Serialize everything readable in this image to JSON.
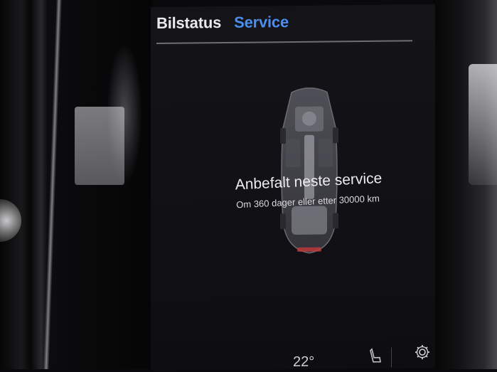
{
  "header": {
    "tabs": [
      {
        "label": "Bilstatus",
        "active": true
      },
      {
        "label": "Service",
        "active": false
      }
    ]
  },
  "service": {
    "headline": "Anbefalt neste service",
    "detail": "Om 360 dager eller etter 30000 km"
  },
  "climate_bar": {
    "temperature": "22°",
    "icons": [
      "seat-heat-icon",
      "settings-gear-icon"
    ]
  },
  "colors": {
    "active_tab": "#e9e9ee",
    "inactive_tab": "#4a8ff0",
    "screen_bg": "#121216"
  }
}
